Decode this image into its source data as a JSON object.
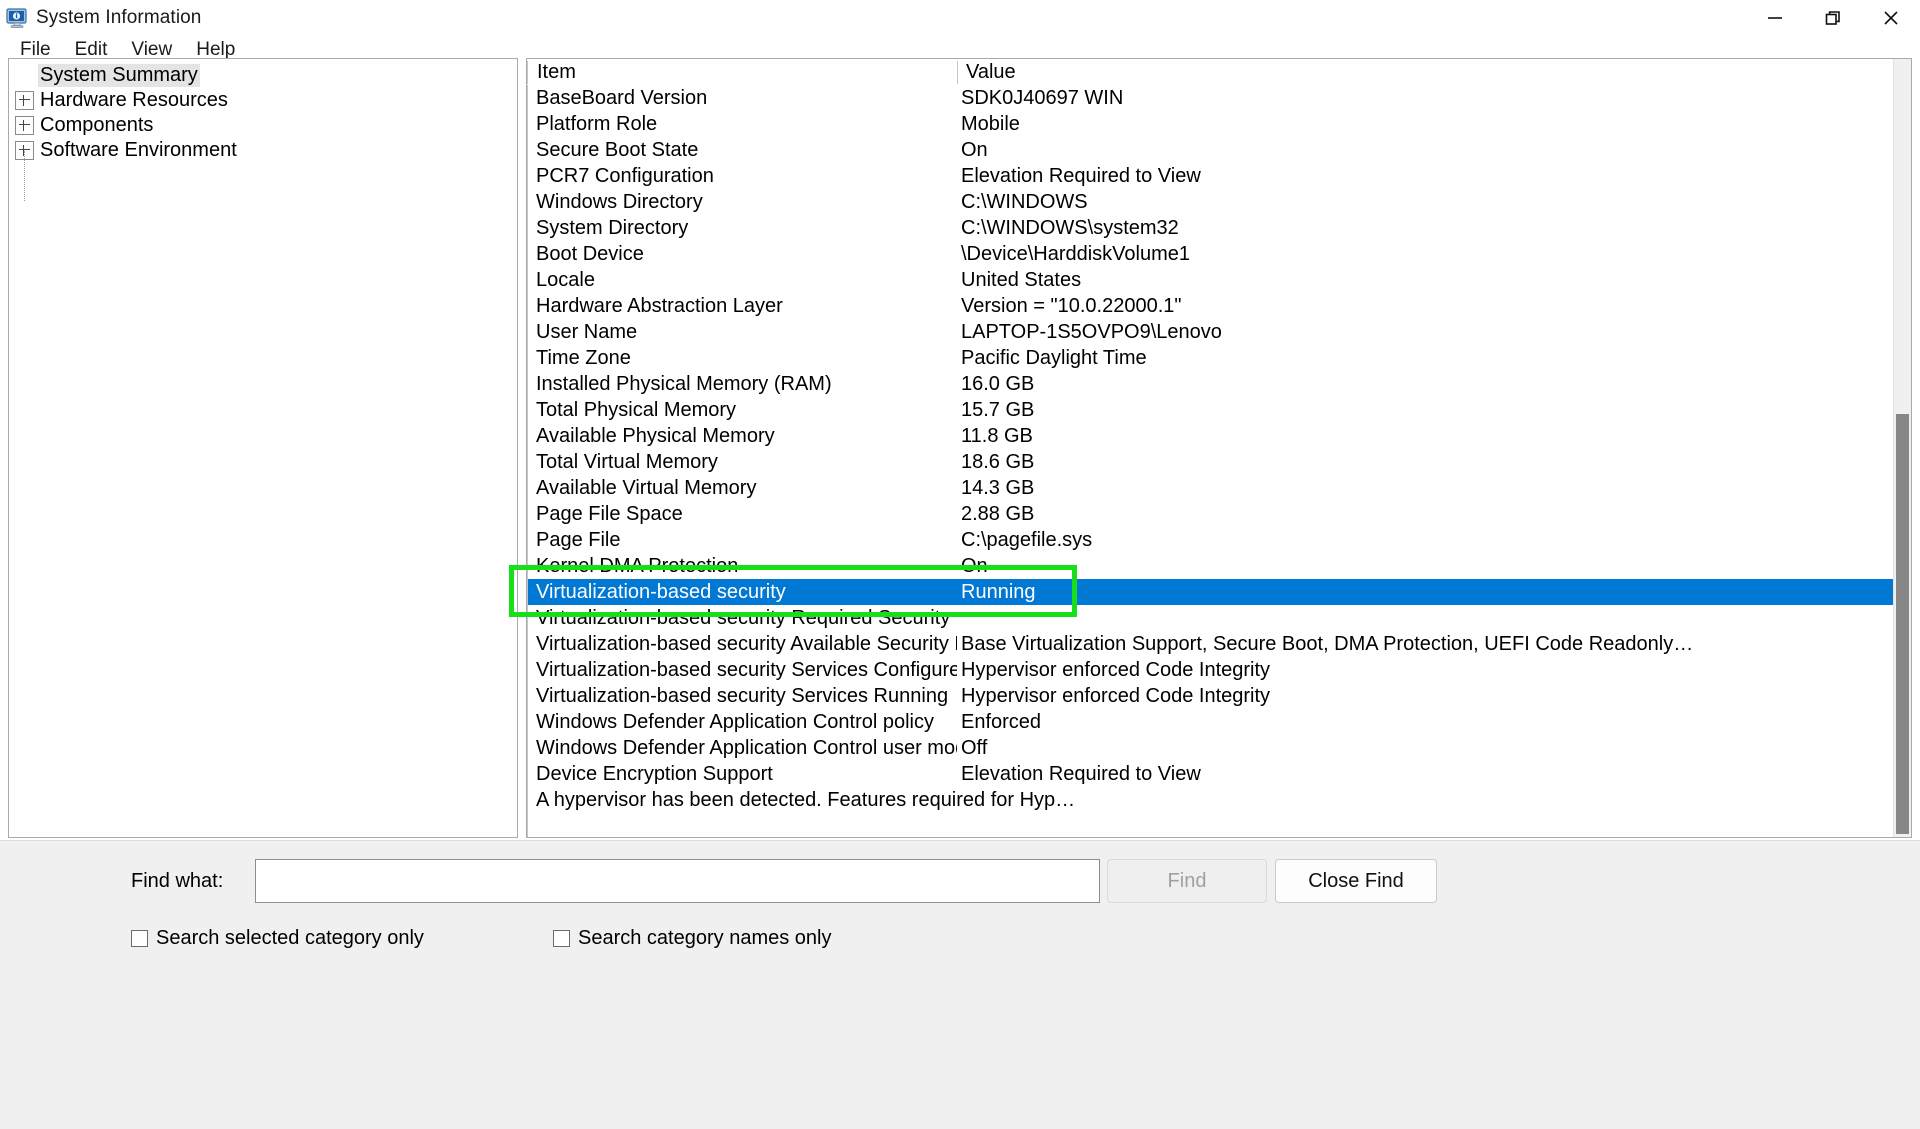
{
  "window": {
    "title": "System Information",
    "icon": "system-information-icon",
    "controls": {
      "minimize": "minimize-icon",
      "restore": "restore-icon",
      "close": "close-icon"
    }
  },
  "menubar": {
    "items": [
      {
        "label": "File"
      },
      {
        "label": "Edit"
      },
      {
        "label": "View"
      },
      {
        "label": "Help"
      }
    ]
  },
  "tree": {
    "items": [
      {
        "label": "System Summary",
        "expandable": false,
        "selected": true
      },
      {
        "label": "Hardware Resources",
        "expandable": true,
        "selected": false
      },
      {
        "label": "Components",
        "expandable": true,
        "selected": false
      },
      {
        "label": "Software Environment",
        "expandable": true,
        "selected": false
      }
    ]
  },
  "list": {
    "columns": [
      {
        "label": "Item"
      },
      {
        "label": "Value"
      }
    ],
    "rows": [
      {
        "item": "BaseBoard Version",
        "value": "SDK0J40697 WIN",
        "selected": false
      },
      {
        "item": "Platform Role",
        "value": "Mobile",
        "selected": false
      },
      {
        "item": "Secure Boot State",
        "value": "On",
        "selected": false
      },
      {
        "item": "PCR7 Configuration",
        "value": "Elevation Required to View",
        "selected": false
      },
      {
        "item": "Windows Directory",
        "value": "C:\\WINDOWS",
        "selected": false
      },
      {
        "item": "System Directory",
        "value": "C:\\WINDOWS\\system32",
        "selected": false
      },
      {
        "item": "Boot Device",
        "value": "\\Device\\HarddiskVolume1",
        "selected": false
      },
      {
        "item": "Locale",
        "value": "United States",
        "selected": false
      },
      {
        "item": "Hardware Abstraction Layer",
        "value": "Version = \"10.0.22000.1\"",
        "selected": false
      },
      {
        "item": "User Name",
        "value": "LAPTOP-1S5OVPO9\\Lenovo",
        "selected": false
      },
      {
        "item": "Time Zone",
        "value": "Pacific Daylight Time",
        "selected": false
      },
      {
        "item": "Installed Physical Memory (RAM)",
        "value": "16.0 GB",
        "selected": false
      },
      {
        "item": "Total Physical Memory",
        "value": "15.7 GB",
        "selected": false
      },
      {
        "item": "Available Physical Memory",
        "value": "11.8 GB",
        "selected": false
      },
      {
        "item": "Total Virtual Memory",
        "value": "18.6 GB",
        "selected": false
      },
      {
        "item": "Available Virtual Memory",
        "value": "14.3 GB",
        "selected": false
      },
      {
        "item": "Page File Space",
        "value": "2.88 GB",
        "selected": false
      },
      {
        "item": "Page File",
        "value": "C:\\pagefile.sys",
        "selected": false
      },
      {
        "item": "Kernel DMA Protection",
        "value": "On",
        "selected": false
      },
      {
        "item": "Virtualization-based security",
        "value": "Running",
        "selected": true
      },
      {
        "item": "Virtualization-based security Required Security Properties",
        "value": "",
        "selected": false
      },
      {
        "item": "Virtualization-based security Available Security Properties",
        "value": "Base Virtualization Support, Secure Boot, DMA Protection, UEFI Code Readonly…",
        "selected": false
      },
      {
        "item": "Virtualization-based security Services Configured",
        "value": "Hypervisor enforced Code Integrity",
        "selected": false
      },
      {
        "item": "Virtualization-based security Services Running",
        "value": "Hypervisor enforced Code Integrity",
        "selected": false
      },
      {
        "item": "Windows Defender Application Control policy",
        "value": "Enforced",
        "selected": false
      },
      {
        "item": "Windows Defender Application Control user mode policy",
        "value": "Off",
        "selected": false
      },
      {
        "item": "Device Encryption Support",
        "value": "Elevation Required to View",
        "selected": false
      },
      {
        "item": "A hypervisor has been detected. Features required for Hyp…",
        "value": "",
        "selected": false,
        "wide": true
      }
    ]
  },
  "findbar": {
    "label": "Find what:",
    "input_value": "",
    "input_placeholder": "",
    "find_button": "Find",
    "find_button_disabled": true,
    "close_find_button": "Close Find",
    "checkbox_selected_category": "Search selected category only",
    "checkbox_selected_category_checked": false,
    "checkbox_category_names": "Search category names only",
    "checkbox_category_names_checked": false
  },
  "colors": {
    "selection_blue": "#0078d4",
    "annotation_green": "#18e018",
    "scrollbar_thumb": "#878787"
  }
}
